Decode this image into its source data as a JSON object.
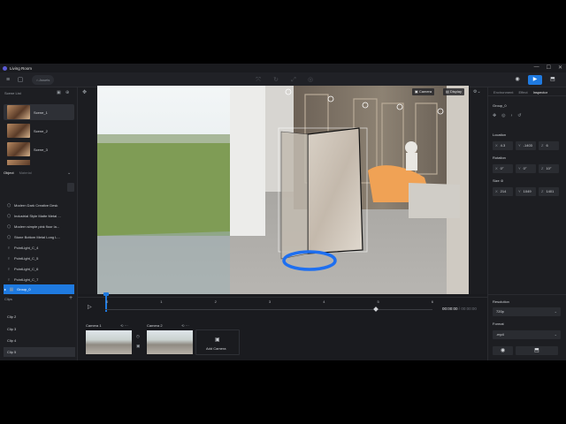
{
  "titlebar": {
    "app_title": "Living Room",
    "window_controls": [
      "—",
      "☐",
      "✕"
    ]
  },
  "toolbar": {
    "assets_label": "Assets"
  },
  "scene_list": {
    "header": "Scene List",
    "scenes": [
      {
        "label": "Scene_1",
        "active": true
      },
      {
        "label": "Scene_2",
        "active": false
      },
      {
        "label": "Scene_3",
        "active": false
      }
    ]
  },
  "object_panel": {
    "tabs": [
      {
        "label": "Object",
        "active": true
      },
      {
        "label": "Material",
        "active": false
      }
    ],
    "items": [
      {
        "icon": "cube-icon",
        "label": "Modern Dark Creative Desk"
      },
      {
        "icon": "cube-icon",
        "label": "Industrial Style Matte Metal ..."
      },
      {
        "icon": "cube-icon",
        "label": "Modern simple pink floor la..."
      },
      {
        "icon": "cube-icon",
        "label": "Stone Bottom Metal Long L..."
      },
      {
        "icon": "bulb-icon",
        "label": "PointLight_C_4"
      },
      {
        "icon": "bulb-icon",
        "label": "PointLight_C_5"
      },
      {
        "icon": "bulb-icon",
        "label": "PointLight_C_6"
      },
      {
        "icon": "bulb-icon",
        "label": "PointLight_C_7"
      },
      {
        "icon": "group-icon",
        "label": "Group_0",
        "selected": true
      }
    ]
  },
  "clips": {
    "header": "Clips",
    "items": [
      {
        "label": "Clip 2"
      },
      {
        "label": "Clip 3"
      },
      {
        "label": "Clip 4"
      },
      {
        "label": "Clip 5",
        "active": true
      }
    ]
  },
  "viewport": {
    "camera_label": "Camera",
    "display_label": "Display"
  },
  "inspector": {
    "tabs": [
      {
        "label": "Environment"
      },
      {
        "label": "Effect"
      },
      {
        "label": "Inspector",
        "active": true
      }
    ],
    "object_name": "Group_0",
    "location": {
      "label": "Location",
      "x": "4.3",
      "y": "-1403",
      "z": "6"
    },
    "rotation": {
      "label": "Rotation",
      "x": "0°",
      "y": "0°",
      "z": "10°"
    },
    "size": {
      "label": "Size",
      "x": "214",
      "y": "1049",
      "z": "1401"
    },
    "resolution": {
      "label": "Resolution",
      "value": "720p"
    },
    "format": {
      "label": "Format",
      "value": ".mp4"
    }
  },
  "timeline": {
    "ticks": [
      "0",
      "1",
      "2",
      "3",
      "4",
      "5",
      "6"
    ],
    "time_current": "00:00:00",
    "time_total": "00:00:00",
    "cameras": [
      {
        "label": "Camera 1"
      },
      {
        "label": "Camera 2"
      }
    ],
    "add_camera_label": "Add Camera"
  },
  "colors": {
    "accent": "#1f7ae0",
    "selection_ring": "#1e6ff0",
    "panel_bg": "#1d1e22"
  }
}
